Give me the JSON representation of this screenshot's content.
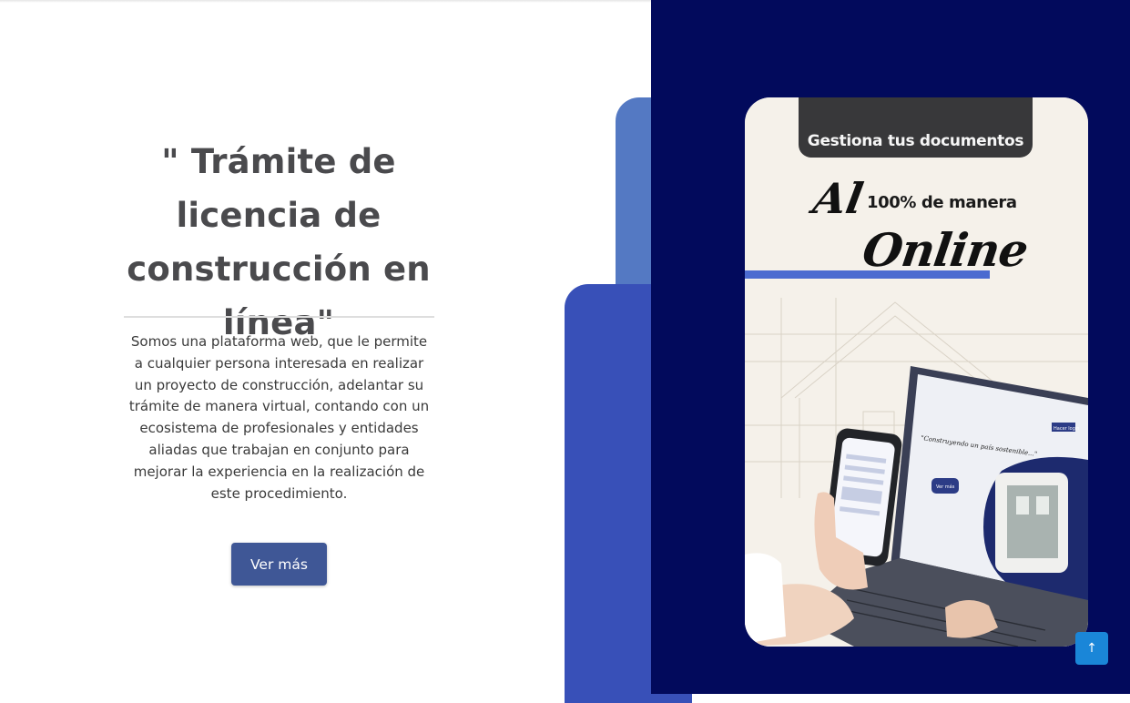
{
  "hero": {
    "title": "\" Trámite de licencia de construcción en línea\"",
    "description": "Somos una plataforma web, que le permite a cualquier persona interesada en realizar un proyecto de construcción, adelantar su trámite de manera virtual, contando con un ecosistema de profesionales y entidades aliadas que trabajan en conjunto para mejorar la experiencia en la realización de este procedimiento.",
    "cta_label": "Ver más"
  },
  "promo": {
    "header": "Gestiona tus documentos",
    "line_al": "Al",
    "line_pct": "100% de manera",
    "line_online": "Online",
    "screen_heading": "\"Construyendo un país sostenible...\"",
    "screen_button": "Ver más",
    "screen_nav_button": "Hacer login"
  },
  "scroll_top": {
    "icon": "arrow-up-icon",
    "glyph": "↑"
  },
  "colors": {
    "navy_panel": "#020a5c",
    "accent_blue": "#3850b8",
    "light_blue": "#5479c3",
    "cta_button": "#3f5796",
    "scroll_button": "#1a86d8"
  }
}
